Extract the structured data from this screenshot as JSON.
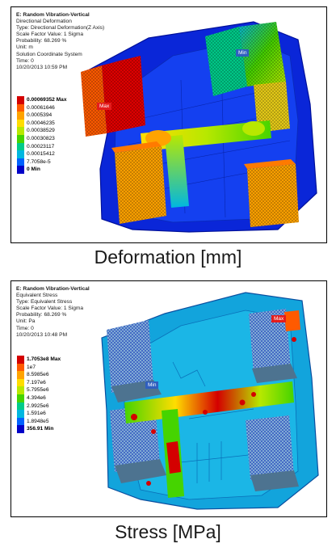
{
  "panels": [
    {
      "info_lines": [
        "E: Random Vibration-Vertical",
        "Directional Deformation",
        "Type: Directional Deformation(Z Axis)",
        "Scale Factor Value: 1 Sigma",
        "Probability: 68.269 %",
        "Unit: m",
        "Solution Coordinate System",
        "Time: 0",
        "10/20/2013 10:59 PM"
      ],
      "legend": [
        {
          "label": "0.00069352 Max",
          "color": "#d40000"
        },
        {
          "label": "0.00061646",
          "color": "#ff5a00"
        },
        {
          "label": "0.0005394",
          "color": "#ffa300"
        },
        {
          "label": "0.00046235",
          "color": "#ffdd00"
        },
        {
          "label": "0.00038529",
          "color": "#b8e800"
        },
        {
          "label": "0.00030823",
          "color": "#45d400"
        },
        {
          "label": "0.00023117",
          "color": "#00cc8a"
        },
        {
          "label": "0.00015412",
          "color": "#00b7e0"
        },
        {
          "label": "7.7058e-5",
          "color": "#0062ff"
        },
        {
          "label": "0 Min",
          "color": "#0000c8"
        }
      ],
      "max_tag": "Max",
      "min_tag": "Min",
      "caption": "Deformation [mm]"
    },
    {
      "info_lines": [
        "E: Random Vibration-Vertical",
        "Equivalent Stress",
        "Type: Equivalent Stress",
        "Scale Factor Value: 1 Sigma",
        "Probability: 68.269 %",
        "Unit: Pa",
        "Time: 0",
        "10/20/2013 10:48 PM"
      ],
      "legend": [
        {
          "label": "1.7053e8 Max",
          "color": "#d40000"
        },
        {
          "label": "1e7",
          "color": "#ff5a00"
        },
        {
          "label": "8.5985e6",
          "color": "#ffa300"
        },
        {
          "label": "7.197e6",
          "color": "#ffdd00"
        },
        {
          "label": "5.7955e6",
          "color": "#b8e800"
        },
        {
          "label": "4.394e6",
          "color": "#45d400"
        },
        {
          "label": "2.9925e6",
          "color": "#00cc8a"
        },
        {
          "label": "1.591e6",
          "color": "#00b7e0"
        },
        {
          "label": "1.8948e5",
          "color": "#0062ff"
        },
        {
          "label": "356.91 Min",
          "color": "#0000c8"
        }
      ],
      "max_tag": "Max",
      "min_tag": "Min",
      "caption": "Stress [MPa]"
    }
  ]
}
